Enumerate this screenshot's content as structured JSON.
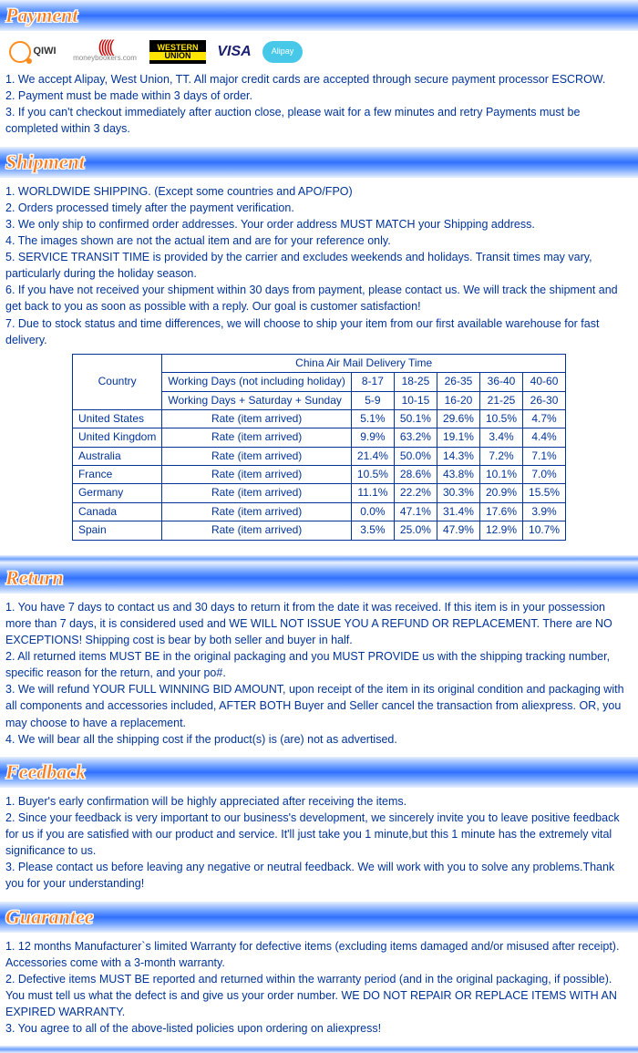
{
  "sections": {
    "payment": {
      "title": "Payment",
      "lines": [
        "1. We accept Alipay, West Union, TT. All major credit cards are accepted through secure payment processor ESCROW.",
        "2. Payment must be made within 3 days of order.",
        "3. If you can't checkout immediately after auction close, please wait for a few minutes and retry Payments must be completed within 3 days."
      ]
    },
    "shipment": {
      "title": "Shipment",
      "lines": [
        "1. WORLDWIDE SHIPPING. (Except some countries and APO/FPO)",
        "2. Orders processed timely after the payment verification.",
        "3. We only ship to confirmed order addresses. Your order address MUST MATCH your Shipping address.",
        "4. The images shown are not the actual item and are for your reference only.",
        "5. SERVICE TRANSIT TIME is provided by the carrier and excludes weekends and holidays. Transit times may vary, particularly during the holiday season.",
        "6. If you have not received your shipment within 30 days from payment, please contact us. We will track the shipment and get back to you as soon as possible with a reply. Our goal is customer satisfaction!",
        "7. Due to stock status and time differences, we will choose to ship your item from our first available warehouse for fast delivery."
      ]
    },
    "return": {
      "title": "Return",
      "lines": [
        "1. You have 7 days to contact us and 30 days to return it from the date it was received. If this item is in your possession more than 7 days, it is considered used and WE WILL NOT ISSUE YOU A REFUND OR REPLACEMENT. There are NO EXCEPTIONS! Shipping cost is bear by both seller and buyer in half.",
        "2. All returned items MUST BE in the original packaging and you MUST PROVIDE us with the shipping tracking number, specific reason for the return, and your po#.",
        "3. We will refund YOUR FULL WINNING BID AMOUNT, upon receipt of the item in its original condition and packaging with all components and accessories included, AFTER BOTH Buyer and Seller cancel the transaction from aliexpress. OR, you may choose to have a replacement.",
        "4. We will bear all the shipping cost if the product(s) is (are) not as advertised."
      ]
    },
    "feedback": {
      "title": "Feedback",
      "lines": [
        "1. Buyer's early confirmation will be highly appreciated after receiving the items.",
        "2. Since your feedback is very important to our business's development, we sincerely invite you to leave positive feedback for us if you are satisfied with our product and service. It'll just take you 1 minute,but this 1 minute has the extremely vital significance to us.",
        "3. Please contact us before leaving any negative or neutral feedback. We will work with you to solve any problems.Thank you for your understanding!"
      ]
    },
    "guarantee": {
      "title": "Guarantee",
      "lines": [
        "1. 12 months Manufacturer`s limited Warranty for defective items (excluding items damaged and/or misused after receipt). Accessories come with a 3-month warranty.",
        "2. Defective items MUST BE reported and returned within the warranty period (and in the original packaging, if possible). You must tell us what the defect is and give us your order number. WE DO NOT REPAIR OR REPLACE ITEMS WITH AN EXPIRED WARRANTY.",
        "3. You agree to all of the above-listed policies upon ordering on aliexpress!"
      ]
    }
  },
  "logos": {
    "qiwi": "QIWI",
    "mb": "moneybookers.com",
    "wu_top": "WESTERN",
    "wu_bot": "UNION",
    "visa": "VISA",
    "ali": "Alipay"
  },
  "chart_data": {
    "type": "table",
    "title": "China Air Mail Delivery Time",
    "country_label": "Country",
    "row1_label": "Working Days (not including holiday)",
    "row2_label": "Working Days + Saturday + Sunday",
    "rate_label": "Rate (item arrived)",
    "col_ranges": [
      "8-17",
      "18-25",
      "26-35",
      "36-40",
      "40-60"
    ],
    "sat_ranges": [
      "5-9",
      "10-15",
      "16-20",
      "21-25",
      "26-30"
    ],
    "rows": [
      {
        "country": "United States",
        "rates": [
          "5.1%",
          "50.1%",
          "29.6%",
          "10.5%",
          "4.7%"
        ]
      },
      {
        "country": "United Kingdom",
        "rates": [
          "9.9%",
          "63.2%",
          "19.1%",
          "3.4%",
          "4.4%"
        ]
      },
      {
        "country": "Australia",
        "rates": [
          "21.4%",
          "50.0%",
          "14.3%",
          "7.2%",
          "7.1%"
        ]
      },
      {
        "country": "France",
        "rates": [
          "10.5%",
          "28.6%",
          "43.8%",
          "10.1%",
          "7.0%"
        ]
      },
      {
        "country": "Germany",
        "rates": [
          "11.1%",
          "22.2%",
          "30.3%",
          "20.9%",
          "15.5%"
        ]
      },
      {
        "country": "Canada",
        "rates": [
          "0.0%",
          "47.1%",
          "31.4%",
          "17.6%",
          "3.9%"
        ]
      },
      {
        "country": "Spain",
        "rates": [
          "3.5%",
          "25.0%",
          "47.9%",
          "12.9%",
          "10.7%"
        ]
      }
    ]
  }
}
